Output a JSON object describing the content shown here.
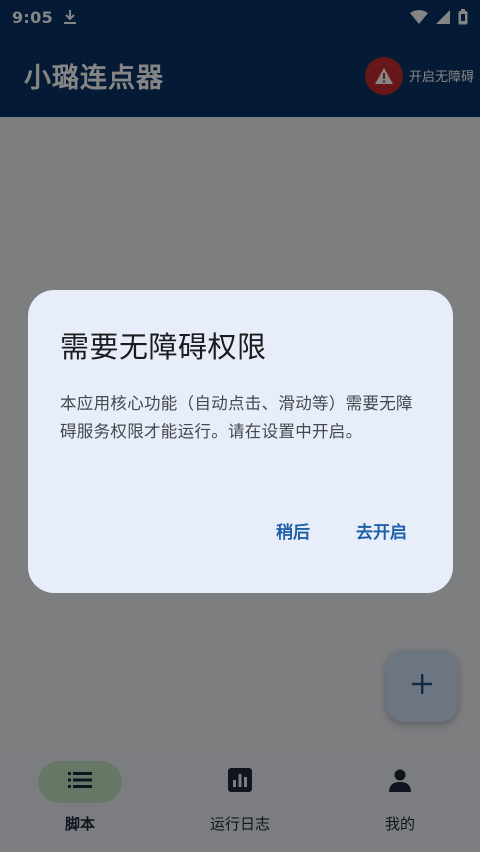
{
  "status_bar": {
    "time": "9:05",
    "icons": [
      "download-icon",
      "wifi-icon",
      "signal-icon",
      "battery-icon"
    ]
  },
  "app_bar": {
    "title": "小璐连点器",
    "accessibility_button": {
      "label": "开启无障碍",
      "icon": "warning-icon"
    }
  },
  "fab": {
    "icon": "plus-icon"
  },
  "bottom_nav": {
    "items": [
      {
        "label": "脚本",
        "icon": "list-icon",
        "active": true
      },
      {
        "label": "运行日志",
        "icon": "bar-chart-icon",
        "active": false
      },
      {
        "label": "我的",
        "icon": "person-icon",
        "active": false
      }
    ]
  },
  "dialog": {
    "title": "需要无障碍权限",
    "body": "本应用核心功能（自动点击、滑动等）需要无障碍服务权限才能运行。请在设置中开启。",
    "actions": {
      "later": "稍后",
      "open": "去开启"
    }
  },
  "colors": {
    "primary": "#0b3466",
    "warning": "#c62d2d",
    "accent": "#1f5fa8",
    "nav_active": "#c4e7c1"
  }
}
